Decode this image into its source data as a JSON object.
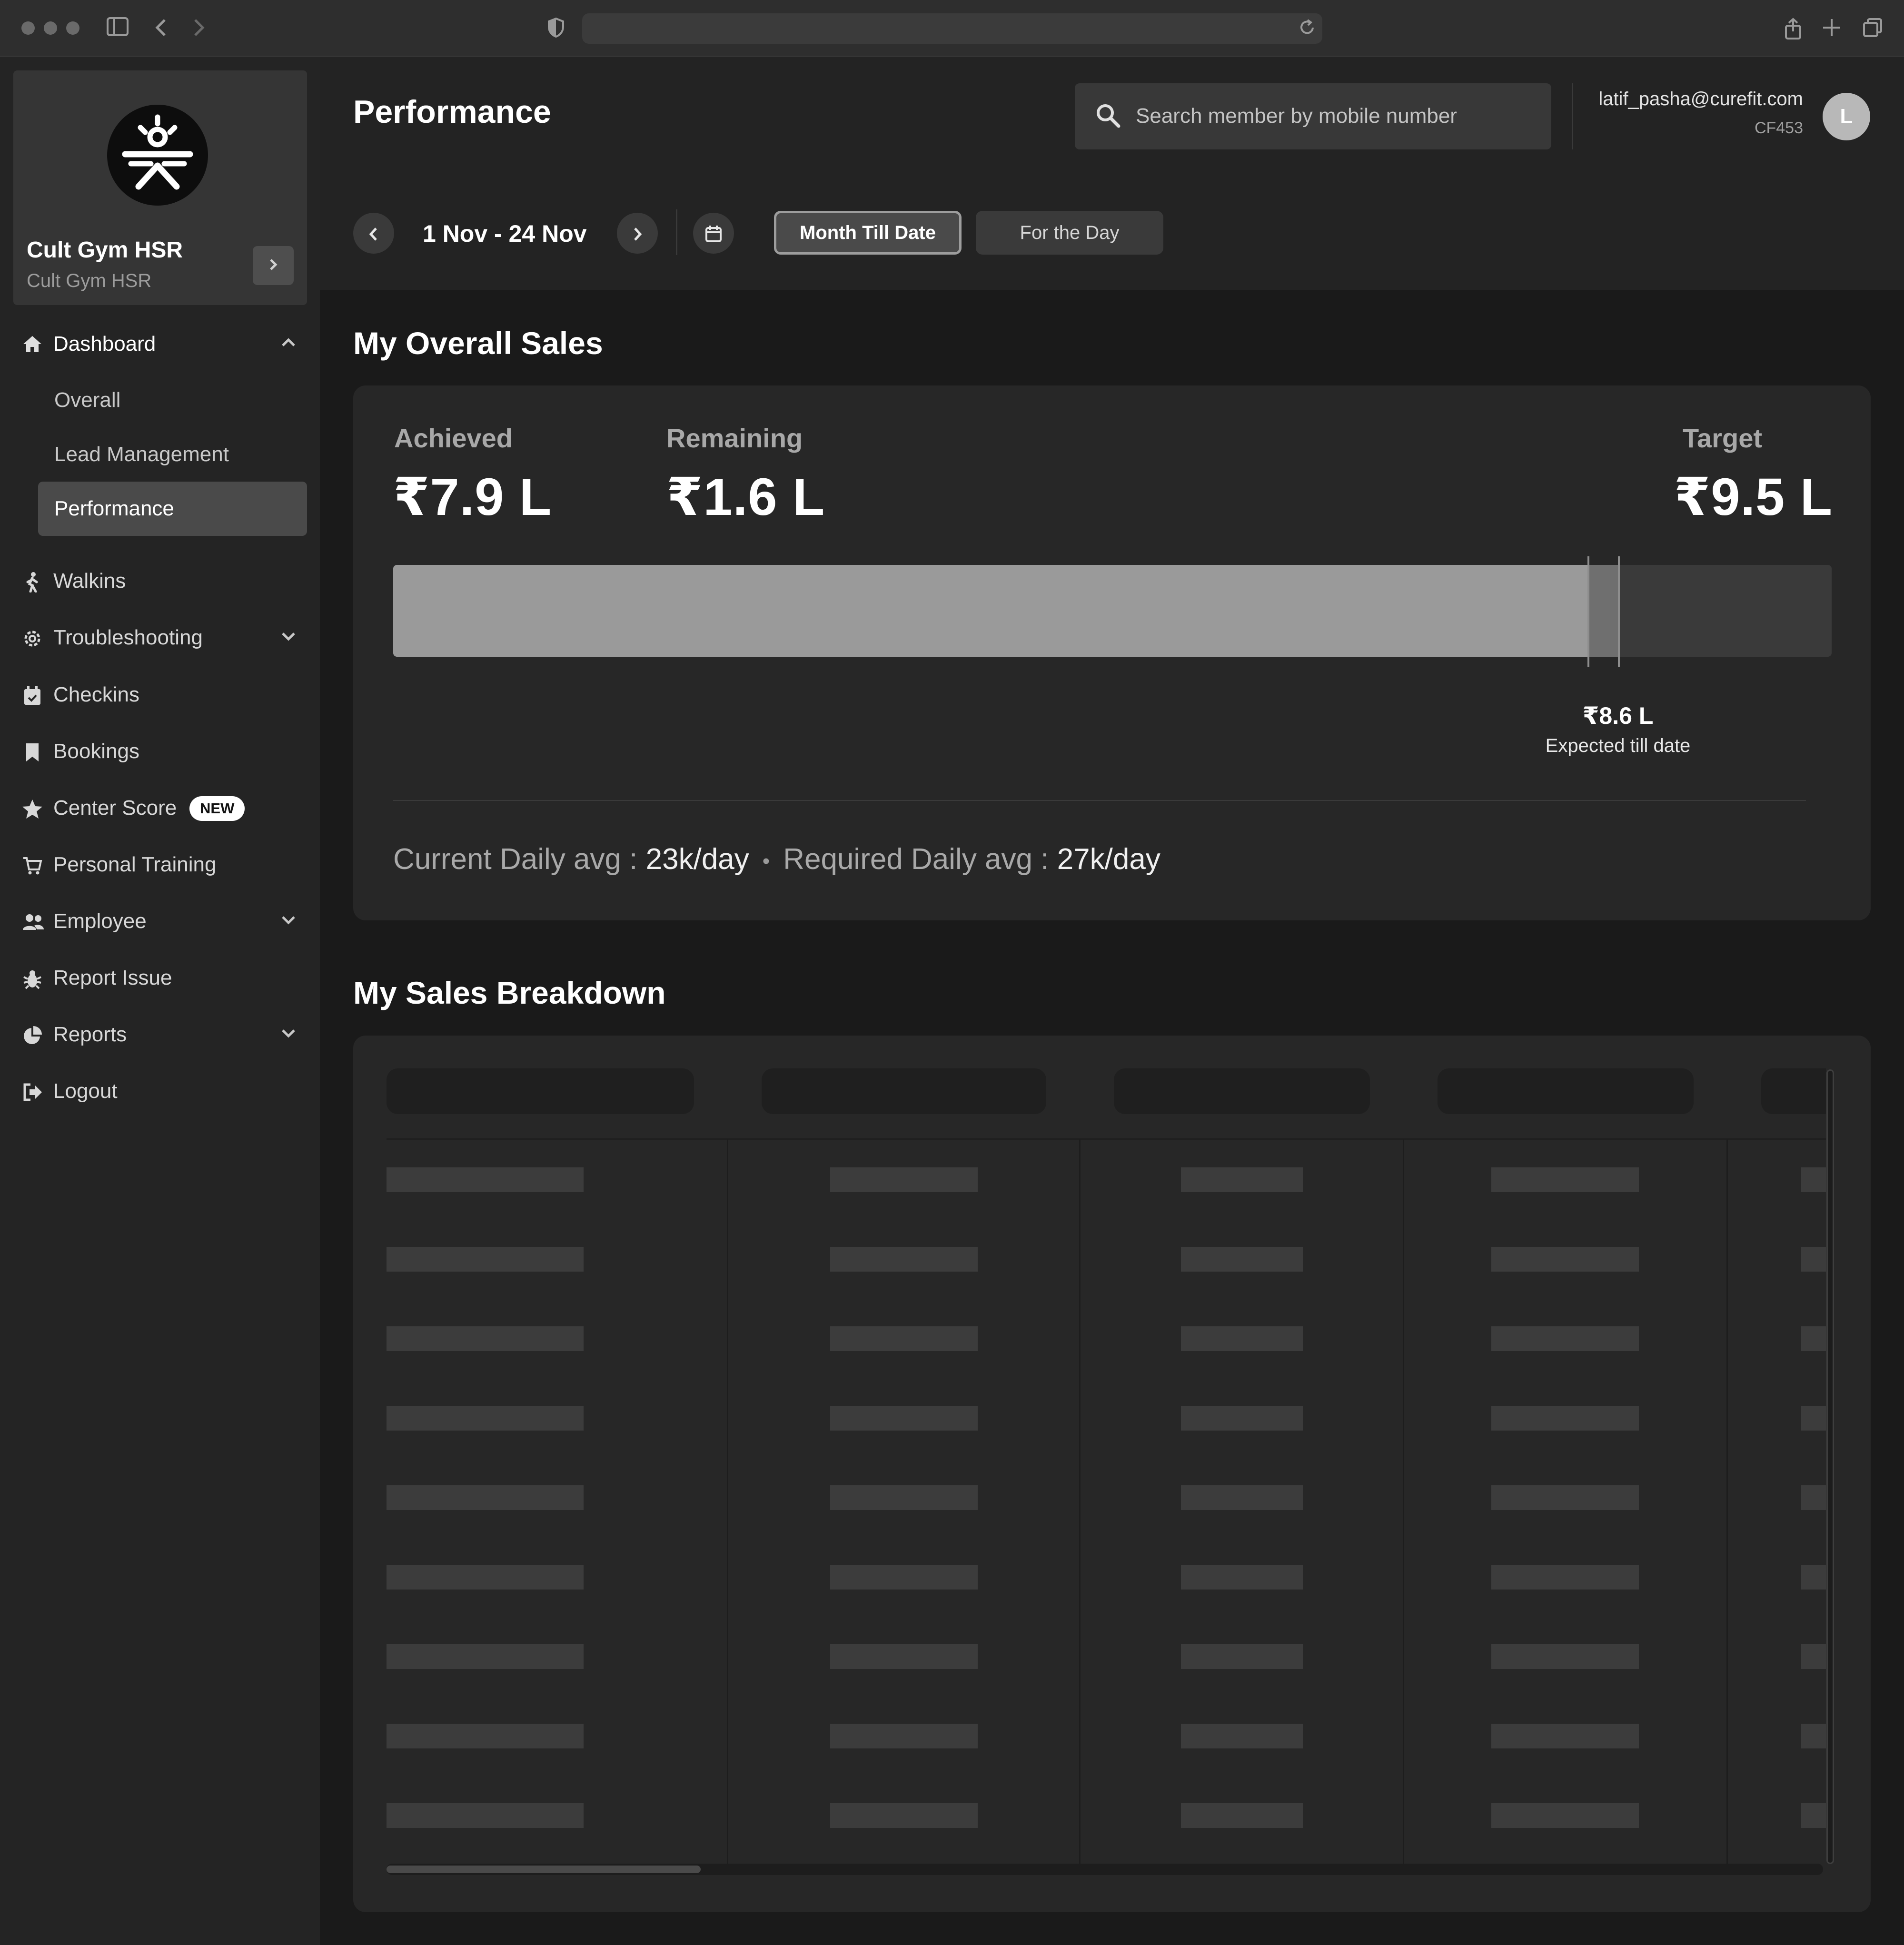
{
  "browser": {
    "url": ""
  },
  "sidebar": {
    "gym_name": "Cult Gym HSR",
    "gym_subtitle": "Cult Gym HSR",
    "items": [
      {
        "label": "Dashboard",
        "icon": "home-icon"
      },
      {
        "label": "Overall"
      },
      {
        "label": "Lead Management"
      },
      {
        "label": "Performance"
      },
      {
        "label": "Walkins",
        "icon": "walking-icon"
      },
      {
        "label": "Troubleshooting",
        "icon": "gear-icon"
      },
      {
        "label": "Checkins",
        "icon": "calendar-check-icon"
      },
      {
        "label": "Bookings",
        "icon": "bookmark-icon"
      },
      {
        "label": "Center Score",
        "icon": "star-icon",
        "badge": "NEW"
      },
      {
        "label": "Personal Training",
        "icon": "cart-icon"
      },
      {
        "label": "Employee",
        "icon": "users-icon"
      },
      {
        "label": "Report Issue",
        "icon": "bug-icon"
      },
      {
        "label": "Reports",
        "icon": "pie-chart-icon"
      },
      {
        "label": "Logout",
        "icon": "logout-icon"
      }
    ]
  },
  "header": {
    "title": "Performance",
    "search_placeholder": "Search member by mobile number",
    "user_email": "latif_pasha@curefit.com",
    "user_code": "CF453",
    "avatar_initial": "L"
  },
  "filters": {
    "date_range": "1 Nov -  24 Nov",
    "tabs": [
      "Month Till Date",
      "For the Day"
    ],
    "active_tab": "Month Till Date"
  },
  "overall_sales": {
    "title": "My Overall Sales",
    "achieved_label": "Achieved",
    "achieved_value": "₹7.9 L",
    "remaining_label": "Remaining",
    "remaining_value": "₹1.6 L",
    "target_label": "Target",
    "target_value": "₹9.5 L",
    "progress_achieved_fraction": 0.831,
    "expected_value": "₹8.6 L",
    "expected_label": "Expected till date",
    "expected_fraction": 0.852,
    "current_avg_label": "Current Daily avg : ",
    "current_avg_value": "23k/day",
    "required_avg_label": "Required Daily avg : ",
    "required_avg_value": "27k/day"
  },
  "breakdown": {
    "title": "My Sales Breakdown",
    "state": "loading"
  },
  "colors": {
    "background": "#1a1a1a",
    "sidebar": "#242424",
    "card": "#272727",
    "progress_fill": "#9a9a9a"
  }
}
